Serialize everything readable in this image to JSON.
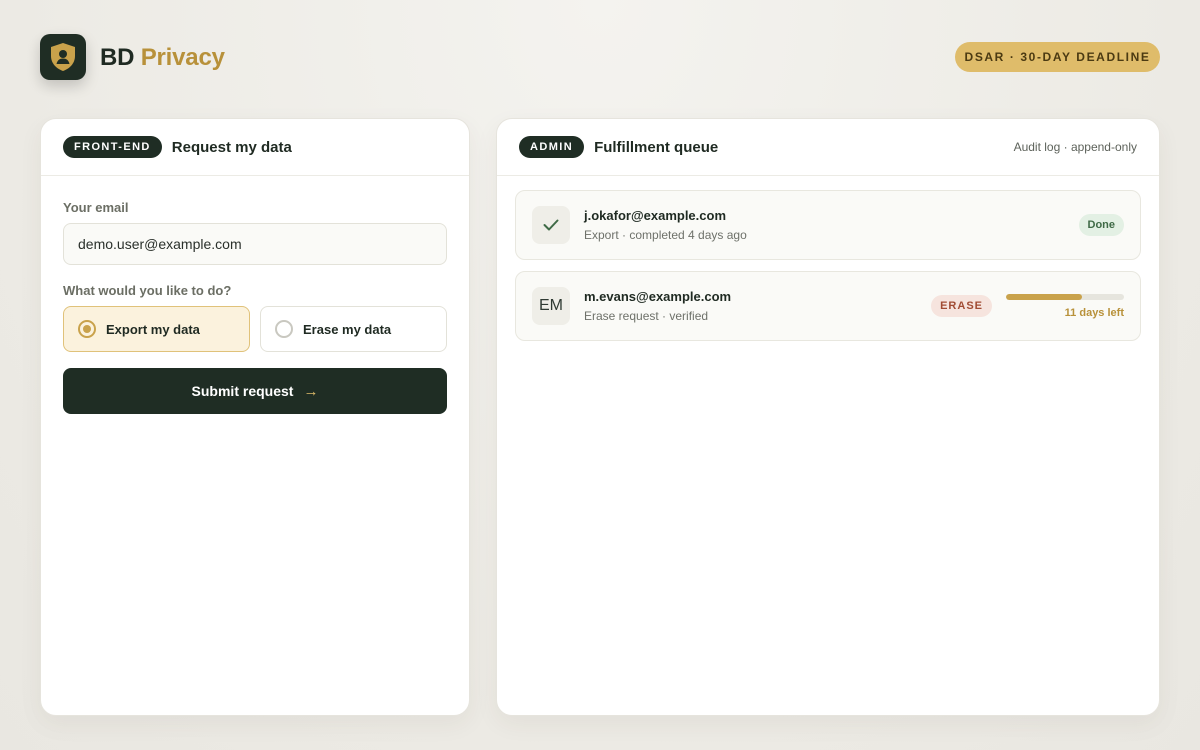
{
  "brand": {
    "name_part1": "BD",
    "name_part2": "Privacy",
    "logo_icon": "shield-user-icon"
  },
  "header": {
    "deadline_pill": "DSAR · 30-DAY DEADLINE"
  },
  "frontend": {
    "tag": "FRONT-END",
    "title": "Request my data",
    "email_label": "Your email",
    "email_value": "demo.user@example.com",
    "question_label": "What would you like to do?",
    "options": [
      {
        "label": "Export my data",
        "selected": true
      },
      {
        "label": "Erase my data",
        "selected": false
      }
    ],
    "submit_label": "Submit request",
    "submit_icon": "arrow-right-icon"
  },
  "admin": {
    "tag": "ADMIN",
    "title": "Fulfillment queue",
    "note": "Audit log · append-only",
    "items": [
      {
        "icon": "check-icon",
        "email": "j.okafor@example.com",
        "detail": "Export · completed 4 days ago",
        "status": "Done"
      },
      {
        "initials": "EM",
        "email": "m.evans@example.com",
        "detail": "Erase request · verified",
        "type_badge": "ERASE",
        "progress_fraction": 0.64,
        "progress_label": "11 days left"
      }
    ]
  },
  "colors": {
    "dark": "#1f2d24",
    "gold": "#c9a24b",
    "gold_light": "#dfbc6a",
    "done_green": "#3f6a46",
    "erase_red": "#a14c34"
  }
}
